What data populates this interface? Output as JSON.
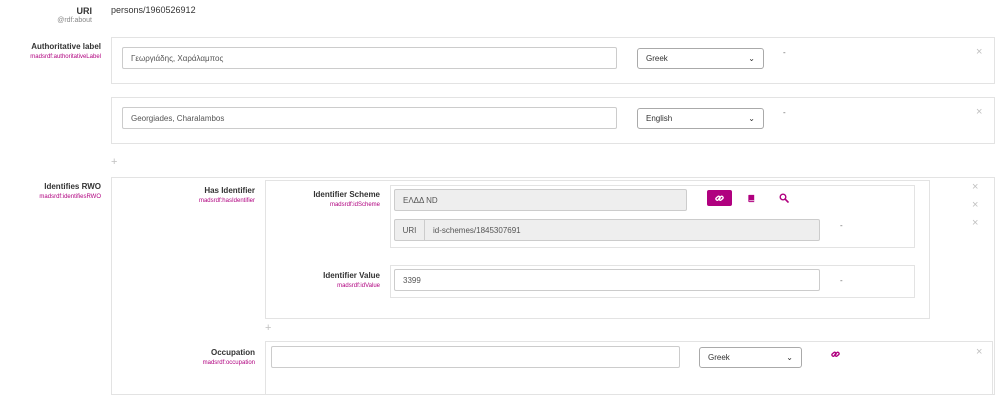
{
  "uri": {
    "label": "URI",
    "sublabel": "@rdf:about",
    "value": "persons/1960526912"
  },
  "authoritative_label": {
    "label": "Authoritative label",
    "sublabel": "madsrdf:authoritativeLabel",
    "entries": [
      {
        "value": "Γεωργιάδης, Χαράλαμπος",
        "language": "Greek",
        "dash": "-"
      },
      {
        "value": "Georgiades, Charalambos",
        "language": "English",
        "dash": "-"
      }
    ]
  },
  "identifies_rwo": {
    "label": "Identifies RWO",
    "sublabel": "madsrdf:identifiesRWO",
    "has_identifier": {
      "label": "Has Identifier",
      "sublabel": "madsrdf:hasIdentifier",
      "scheme": {
        "label": "Identifier Scheme",
        "sublabel": "madsrdf:idScheme",
        "value": "ΕΛΔΔ ND",
        "uri_prefix": "URI",
        "uri_value": "id-schemes/1845307691",
        "dash": "-"
      },
      "value": {
        "label": "Identifier Value",
        "sublabel": "madsrdf:idValue",
        "value": "3399",
        "dash": "-"
      }
    },
    "occupation": {
      "label": "Occupation",
      "sublabel": "madsrdf:occupation",
      "value": "",
      "language": "Greek"
    }
  },
  "glyphs": {
    "close": "×",
    "plus": "+",
    "chevron": "⌄"
  },
  "colors": {
    "accent": "#b0007f",
    "panel_border": "#e3e3e3",
    "readonly_bg": "#eeeeee"
  }
}
